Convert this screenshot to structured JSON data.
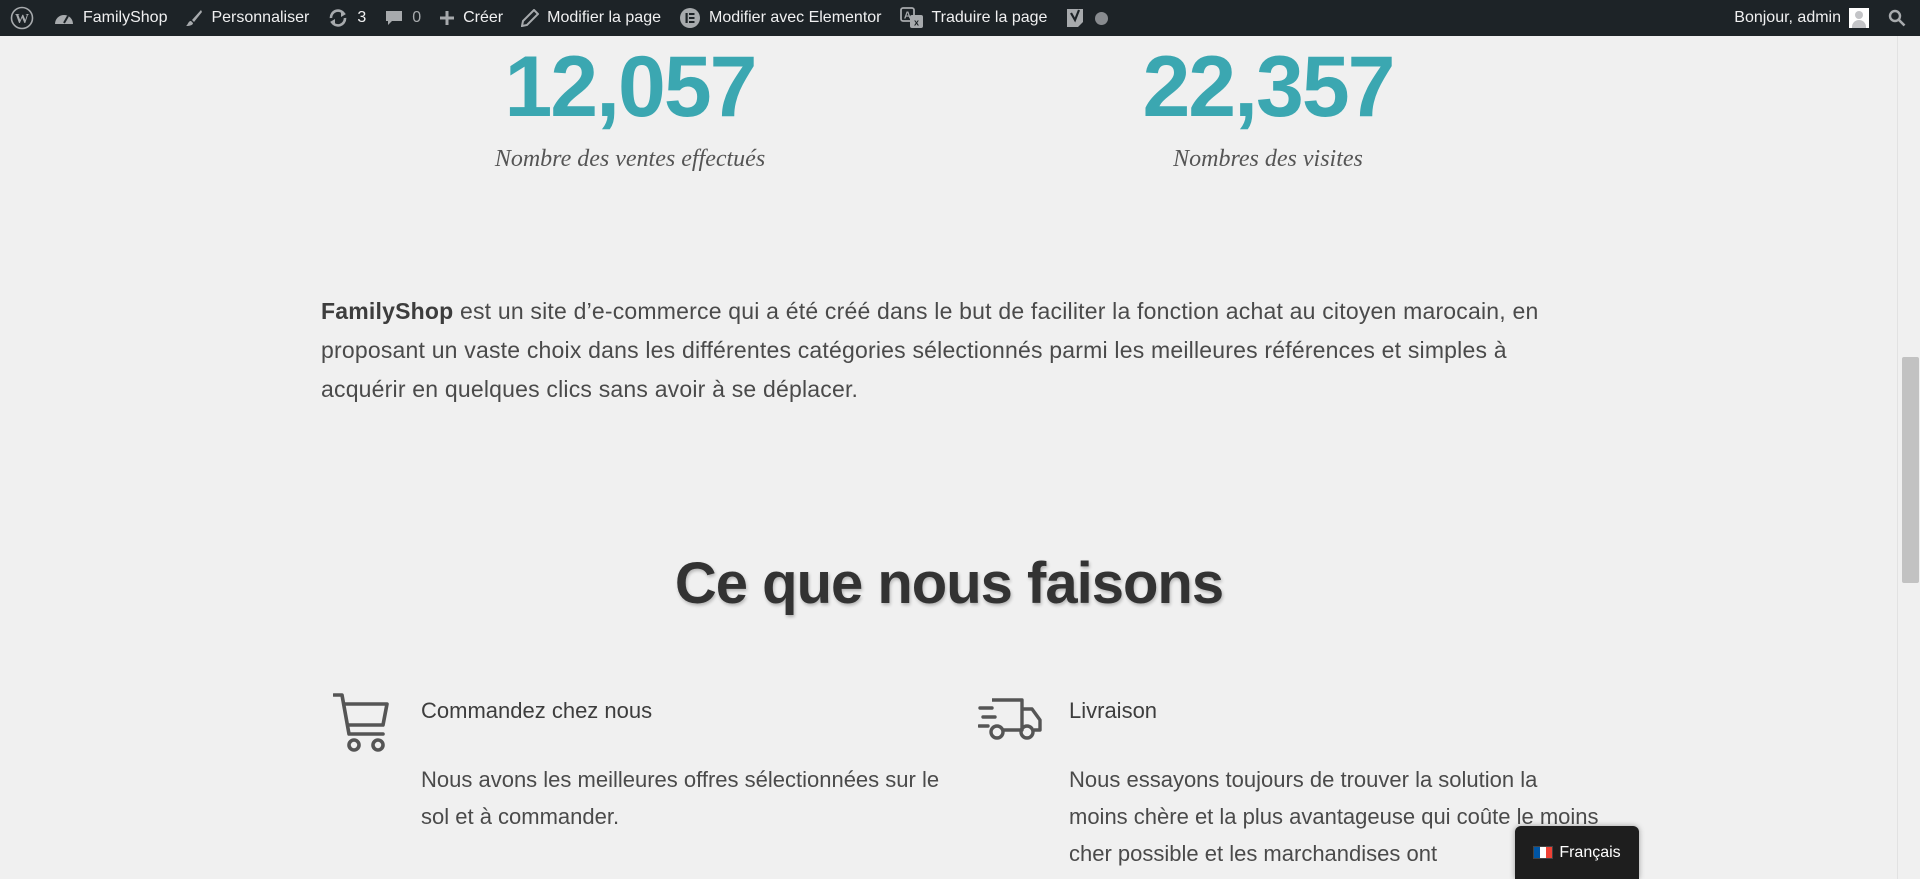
{
  "adminbar": {
    "site_name": "FamilyShop",
    "customize": "Personnaliser",
    "updates_count": "3",
    "comments_count": "0",
    "new": "Créer",
    "edit_page": "Modifier la page",
    "edit_elementor": "Modifier avec Elementor",
    "translate_page": "Traduire la page",
    "greeting": "Bonjour, admin"
  },
  "counters": [
    {
      "value": "12,057",
      "caption": "Nombre des ventes effectués"
    },
    {
      "value": "22,357",
      "caption": "Nombres des visites"
    }
  ],
  "intro": {
    "brand": "FamilyShop",
    "text": " est un site d’e-commerce qui a été créé dans le but de faciliter la fonction achat au citoyen marocain, en proposant un vaste choix dans les différentes catégories sélectionnés parmi les meilleures références et simples à acquérir en quelques clics sans avoir à se déplacer."
  },
  "section_title": "Ce que nous faisons",
  "features": [
    {
      "icon": "shopping-cart-icon",
      "title": "Commandez chez nous",
      "text": " Nous avons les meilleures offres sélectionnées sur le sol et à commander."
    },
    {
      "icon": "delivery-truck-icon",
      "title": "Livraison",
      "text": " Nous essayons toujours de trouver la solution la moins chère et la plus avantageuse qui coûte le moins cher possible et les marchandises ont"
    }
  ],
  "language_switcher": {
    "label": "Français",
    "flag": "france-flag-icon"
  },
  "colors": {
    "accent": "#3ba7b1",
    "adminbar": "#1d2327",
    "background": "#f0f0f0"
  }
}
